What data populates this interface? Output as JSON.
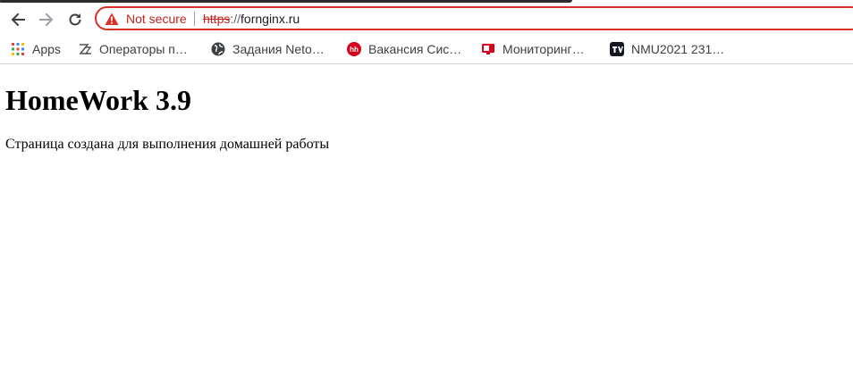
{
  "browser": {
    "security_label": "Not secure",
    "url_scheme": "https",
    "url_separator": "://",
    "url_host": "fornginx.ru"
  },
  "bookmarks": [
    {
      "label": "Apps",
      "icon": "apps-grid-icon"
    },
    {
      "label": "Операторы п…",
      "icon": "zz-icon"
    },
    {
      "label": "Задания Neto…",
      "icon": "globe-icon"
    },
    {
      "label": "Вакансия Сис…",
      "icon": "hh-icon"
    },
    {
      "label": "Мониторинг…",
      "icon": "monitor-icon"
    },
    {
      "label": "NMU2021 231…",
      "icon": "tv-icon"
    }
  ],
  "page": {
    "heading": "HomeWork 3.9",
    "text": "Страница создана для выполнения домашней работы"
  },
  "colors": {
    "warning": "#d93025",
    "hh": "#d6001c"
  }
}
